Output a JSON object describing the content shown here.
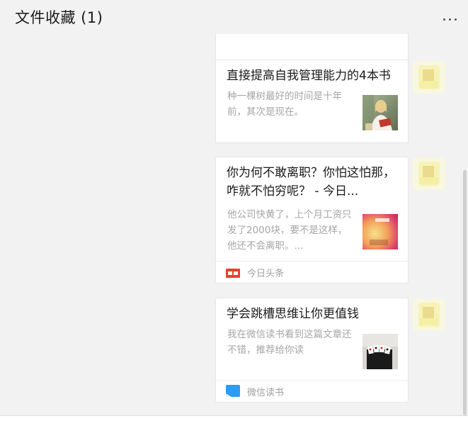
{
  "window": {
    "title": "文件收藏 (1)"
  },
  "messages": [
    {
      "title": "直接提高自我管理能力的4本书",
      "description": "种一棵树最好的时间是十年前，其次是现在。",
      "thumbnail_icon": "woman-reading-thumbnail"
    },
    {
      "title": "你为何不敢离职？你怕这怕那，咋就不怕穷呢？ - 今日...",
      "description": "他公司快黄了，上个月工资只发了2000块，要不是这样，他还不会离职。...",
      "thumbnail_icon": "blurred-book-thumbnail",
      "source": {
        "icon_text": "头条",
        "label": "今日头条"
      }
    },
    {
      "title": "学会跳槽思维让你更值钱",
      "description": "我在微信读书看到这篇文章还不错，推荐给你读",
      "thumbnail_icon": "cards-thumbnail",
      "source": {
        "label": "微信读书"
      }
    }
  ],
  "colors": {
    "background": "#f2f2f2",
    "card": "#ffffff",
    "title_text": "#1a1a1a",
    "muted_text": "#a6a6a6",
    "toutiao_red": "#e8402d",
    "weread_blue": "#2f9bf0",
    "avatar_yellow": "#f6f2a6"
  }
}
